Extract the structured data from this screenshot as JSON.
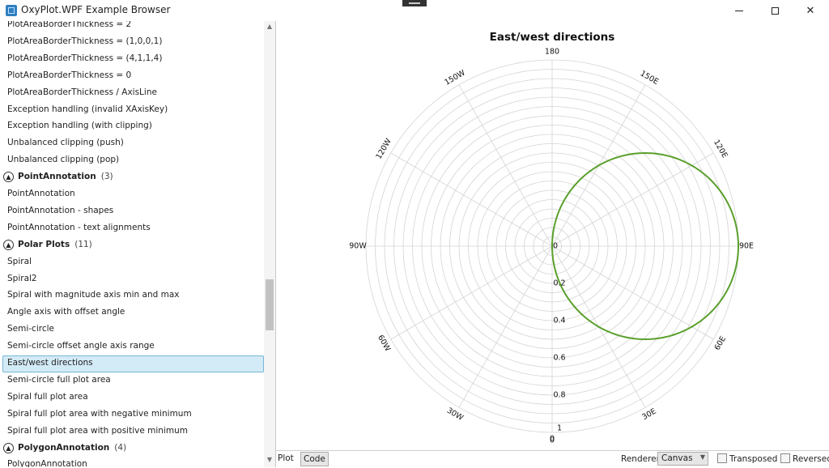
{
  "window": {
    "title": "OxyPlot.WPF Example Browser",
    "controls": [
      "minimize",
      "maximize",
      "close"
    ]
  },
  "sidebar": {
    "rows": [
      {
        "kind": "item",
        "label": "PlotAreaBorderThickness = 2"
      },
      {
        "kind": "item",
        "label": "PlotAreaBorderThickness = (1,0,0,1)"
      },
      {
        "kind": "item",
        "label": "PlotAreaBorderThickness = (4,1,1,4)"
      },
      {
        "kind": "item",
        "label": "PlotAreaBorderThickness = 0"
      },
      {
        "kind": "item",
        "label": "PlotAreaBorderThickness / AxisLine"
      },
      {
        "kind": "item",
        "label": "Exception handling (invalid XAxisKey)"
      },
      {
        "kind": "item",
        "label": "Exception handling (with clipping)"
      },
      {
        "kind": "item",
        "label": "Unbalanced clipping (push)"
      },
      {
        "kind": "item",
        "label": "Unbalanced clipping (pop)"
      },
      {
        "kind": "group",
        "label": "PointAnnotation",
        "count": "(3)"
      },
      {
        "kind": "item",
        "label": "PointAnnotation"
      },
      {
        "kind": "item",
        "label": "PointAnnotation - shapes"
      },
      {
        "kind": "item",
        "label": "PointAnnotation - text alignments"
      },
      {
        "kind": "group",
        "label": "Polar Plots",
        "count": "(11)"
      },
      {
        "kind": "item",
        "label": "Spiral"
      },
      {
        "kind": "item",
        "label": "Spiral2"
      },
      {
        "kind": "item",
        "label": "Spiral with magnitude axis min and max"
      },
      {
        "kind": "item",
        "label": "Angle axis with offset angle"
      },
      {
        "kind": "item",
        "label": "Semi-circle"
      },
      {
        "kind": "item",
        "label": "Semi-circle offset angle axis range"
      },
      {
        "kind": "item",
        "label": "East/west directions",
        "selected": true
      },
      {
        "kind": "item",
        "label": "Semi-circle full plot area"
      },
      {
        "kind": "item",
        "label": "Spiral full plot area"
      },
      {
        "kind": "item",
        "label": "Spiral full plot area with negative minimum"
      },
      {
        "kind": "item",
        "label": "Spiral full plot area with positive minimum"
      },
      {
        "kind": "group",
        "label": "PolygonAnnotation",
        "count": "(4)"
      },
      {
        "kind": "item",
        "label": "PolygonAnnotation"
      }
    ]
  },
  "bottombar": {
    "tab_plot": "Plot",
    "tab_code": "Code",
    "renderer_label": "Renderer:",
    "renderer_value": "Canvas",
    "transposed_label": "Transposed",
    "reversed_label": "Reversed"
  },
  "chart_data": {
    "type": "line",
    "coordinate_system": "polar",
    "title": "East/west directions",
    "angle_tick_labels": [
      "180",
      "150E",
      "120E",
      "90E",
      "60E",
      "30E",
      "0",
      "30W",
      "60W",
      "90W",
      "120W",
      "150W"
    ],
    "angle_tick_degrees": [
      180,
      150,
      120,
      90,
      60,
      30,
      0,
      -30,
      -60,
      -90,
      -120,
      -150
    ],
    "magnitude_tick_labels": [
      "0",
      "0.2",
      "0.4",
      "0.6",
      "0.8",
      "1"
    ],
    "magnitude_range": [
      0,
      1
    ],
    "minor_grid_step": 0.05,
    "grid": true,
    "series": [
      {
        "color": "#5aa02c",
        "function": "r = cos(theta)",
        "theta_range_deg": [
          -90,
          90
        ]
      }
    ]
  },
  "colors": {
    "grid": "#d4d4d4",
    "series": "#5aa02c",
    "selection_bg": "#d3ebf7",
    "selection_border": "#7ab6d6"
  }
}
